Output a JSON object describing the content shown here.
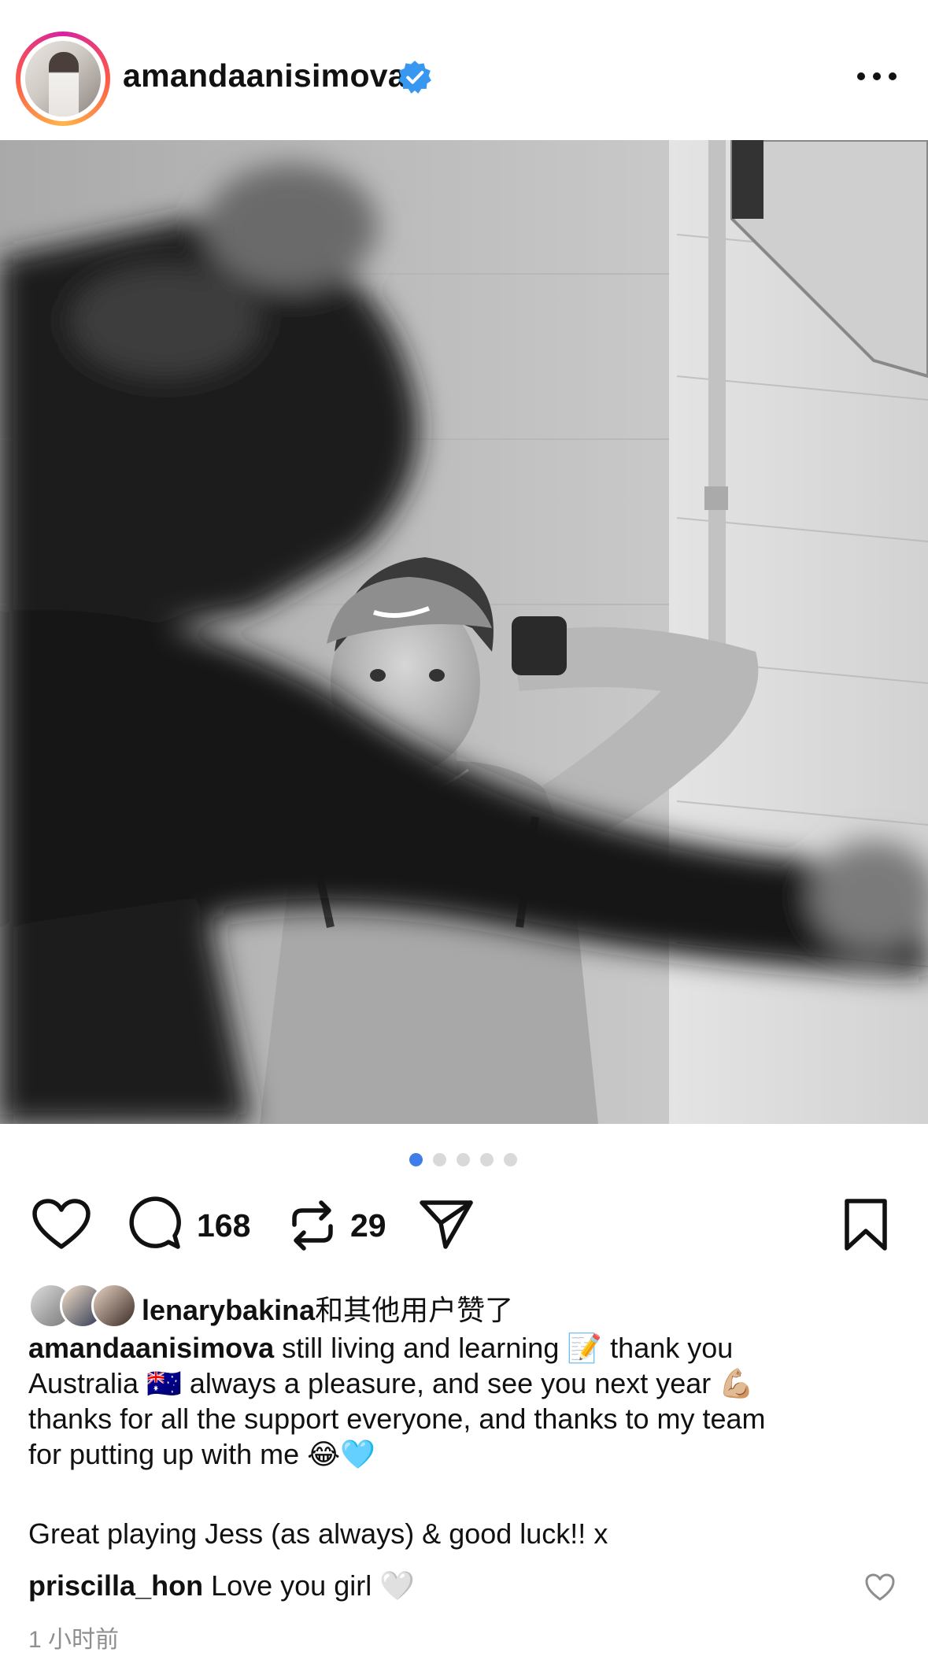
{
  "post": {
    "username": "amandaanisimova",
    "verified": true,
    "photo_alt": "",
    "carousel": {
      "count": 5,
      "active_index": 0
    }
  },
  "actions": {
    "comment_count": "168",
    "repost_count": "29"
  },
  "likes": {
    "liker_username": "lenarybakina",
    "suffix": "和其他用户赞了"
  },
  "caption": {
    "username": "amandaanisimova",
    "line1": " still living and learning 📝 thank you",
    "line2": "Australia 🇦🇺 always a pleasure, and see you next year 💪🏼",
    "line3": "thanks for all the support everyone, and thanks to my team",
    "line4": "for putting up with me 😂🩵",
    "line5": "Great playing Jess (as always) & good luck!! x"
  },
  "comment": {
    "username": "priscilla_hon",
    "text": " Love you girl 🤍"
  },
  "timestamp": "1 小时前",
  "colors": {
    "accent_blue": "#3f7ee8",
    "verified_blue": "#3897f0",
    "muted_text": "#8e8e8e"
  }
}
